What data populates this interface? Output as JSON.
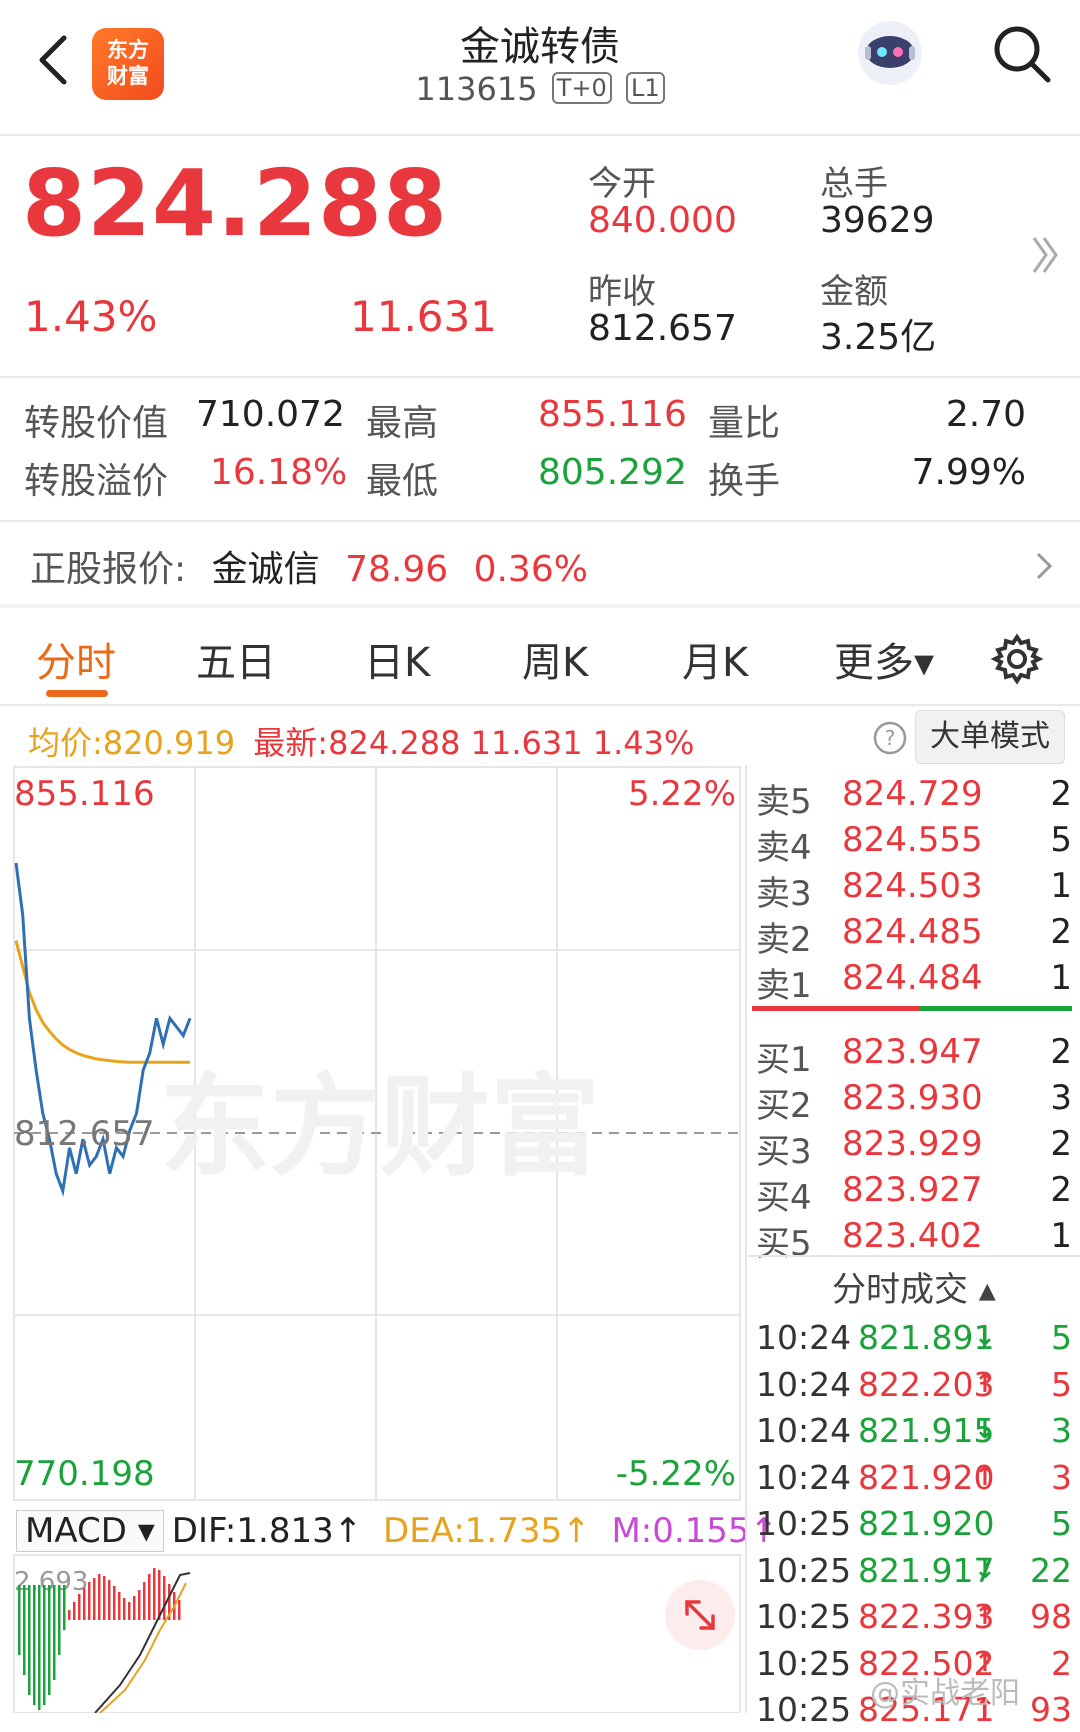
{
  "header": {
    "title": "金诚转债",
    "code": "113615",
    "tags": [
      "T+0",
      "L1"
    ],
    "logo_text": [
      "东方",
      "财富"
    ]
  },
  "quote": {
    "price": "824.288",
    "change_pct": "1.43%",
    "change": "11.631",
    "open_label": "今开",
    "open": "840.000",
    "volume_label": "总手",
    "volume": "39629",
    "prev_close_label": "昨收",
    "prev_close": "812.657",
    "amount_label": "金额",
    "amount": "3.25亿"
  },
  "stats": {
    "conv_value_label": "转股价值",
    "conv_value": "710.072",
    "high_label": "最高",
    "high": "855.116",
    "vol_ratio_label": "量比",
    "vol_ratio": "2.70",
    "premium_label": "转股溢价",
    "premium": "16.18%",
    "low_label": "最低",
    "low": "805.292",
    "turnover_label": "换手",
    "turnover": "7.99%"
  },
  "underlying": {
    "label": "正股报价:",
    "name": "金诚信",
    "price": "78.96",
    "pct": "0.36%"
  },
  "tabs": [
    "分时",
    "五日",
    "日K",
    "周K",
    "月K",
    "更多▾"
  ],
  "info": {
    "avg_label": "均价:",
    "avg": "820.919",
    "latest_label": "最新:",
    "latest": "824.288 11.631 1.43%",
    "big_order_mode": "大单模式"
  },
  "chart": {
    "y_top": "855.116",
    "y_bottom": "770.198",
    "pct_top": "5.22%",
    "pct_bottom": "-5.22%",
    "ref_line": "812.657",
    "watermark": "东方财富",
    "macd_label": "MACD ▾",
    "dif": "DIF:1.813↑",
    "dea": "DEA:1.735↑",
    "m": "M:0.155↑",
    "macd_top": "2.693"
  },
  "chart_data": {
    "type": "line",
    "series": [
      {
        "values": [
          844,
          838,
          826,
          820,
          815,
          812,
          808,
          806,
          811,
          808,
          812,
          809,
          810,
          812,
          808,
          811,
          810,
          813,
          815,
          820,
          822,
          826,
          823,
          826,
          825,
          824,
          826
        ]
      },
      {
        "values": [
          835,
          832,
          829,
          827,
          825.5,
          824.5,
          823.6,
          822.9,
          822.4,
          822,
          821.7,
          821.5,
          821.3,
          821.2,
          821.1,
          821,
          820.95,
          820.9,
          820.9,
          820.9,
          820.9,
          820.9,
          820.9,
          820.9,
          820.9,
          820.9,
          820.9
        ]
      }
    ],
    "ylim": [
      770.198,
      855.116
    ],
    "colors": {
      "price": "#2f6fb5",
      "avg": "#e8a21c"
    }
  },
  "orderbook": {
    "asks": [
      {
        "label": "卖5",
        "price": "824.729",
        "vol": "2"
      },
      {
        "label": "卖4",
        "price": "824.555",
        "vol": "5"
      },
      {
        "label": "卖3",
        "price": "824.503",
        "vol": "1"
      },
      {
        "label": "卖2",
        "price": "824.485",
        "vol": "2"
      },
      {
        "label": "卖1",
        "price": "824.484",
        "vol": "1"
      }
    ],
    "bids": [
      {
        "label": "买1",
        "price": "823.947",
        "vol": "2"
      },
      {
        "label": "买2",
        "price": "823.930",
        "vol": "3"
      },
      {
        "label": "买3",
        "price": "823.929",
        "vol": "2"
      },
      {
        "label": "买4",
        "price": "823.927",
        "vol": "2"
      },
      {
        "label": "买5",
        "price": "823.402",
        "vol": "1"
      }
    ]
  },
  "trades": {
    "title": "分时成交 ▴",
    "rows": [
      {
        "time": "10:24",
        "price": "821.891",
        "dir": "↓",
        "vol": "5",
        "color": "#1aa33a"
      },
      {
        "time": "10:24",
        "price": "822.203",
        "dir": "↑",
        "vol": "5",
        "color": "#e8383d"
      },
      {
        "time": "10:24",
        "price": "821.915",
        "dir": "↓",
        "vol": "3",
        "color": "#1aa33a"
      },
      {
        "time": "10:24",
        "price": "821.920",
        "dir": "↑",
        "vol": "3",
        "color": "#e8383d"
      },
      {
        "time": "10:25",
        "price": "821.920",
        "dir": "",
        "vol": "5",
        "color": "#1aa33a"
      },
      {
        "time": "10:25",
        "price": "821.917",
        "dir": "↓",
        "vol": "22",
        "color": "#1aa33a"
      },
      {
        "time": "10:25",
        "price": "822.393",
        "dir": "↑",
        "vol": "98",
        "color": "#e8383d"
      },
      {
        "time": "10:25",
        "price": "822.502",
        "dir": "↑",
        "vol": "2",
        "color": "#e8383d"
      },
      {
        "time": "10:25",
        "price": "825.171",
        "dir": "↑",
        "vol": "93",
        "color": "#e8383d"
      }
    ]
  },
  "credit": "@实战老阳"
}
